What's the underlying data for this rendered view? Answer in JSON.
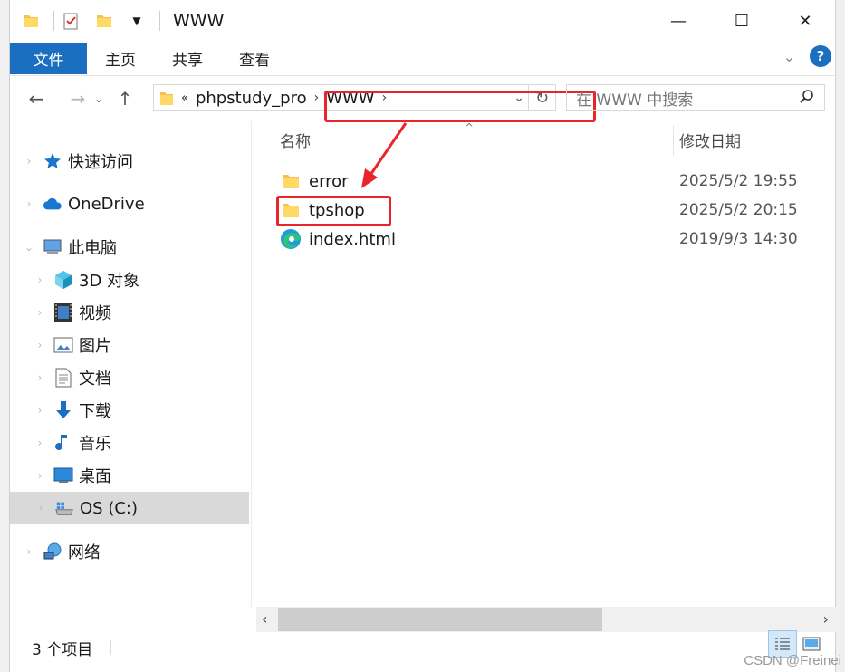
{
  "window": {
    "title": "WWW"
  },
  "ribbon": {
    "tabs": [
      "文件",
      "主页",
      "共享",
      "查看"
    ]
  },
  "address": {
    "overflow": "«",
    "crumbs": [
      "phpstudy_pro",
      "WWW"
    ]
  },
  "search": {
    "placeholder": "在 WWW 中搜索"
  },
  "sidebar": {
    "quick_access": "快速访问",
    "onedrive": "OneDrive",
    "this_pc": "此电脑",
    "objects3d": "3D 对象",
    "videos": "视频",
    "pictures": "图片",
    "documents": "文档",
    "downloads": "下载",
    "music": "音乐",
    "desktop": "桌面",
    "os_c": "OS (C:)",
    "network": "网络"
  },
  "list": {
    "col_name": "名称",
    "col_date": "修改日期",
    "rows": [
      {
        "name": "error",
        "date": "2025/5/2 19:55",
        "icon": "folder-icon"
      },
      {
        "name": "tpshop",
        "date": "2025/5/2 20:15",
        "icon": "folder-icon"
      },
      {
        "name": "index.html",
        "date": "2019/9/3 14:30",
        "icon": "edge-icon"
      }
    ]
  },
  "status": {
    "count": "3 个项目"
  },
  "watermark": "CSDN @Freinei",
  "colors": {
    "accent": "#1a6fc0",
    "highlight_red": "#e8262a",
    "selected_bg": "#d9d9d9",
    "folder": "#f2c24f"
  }
}
